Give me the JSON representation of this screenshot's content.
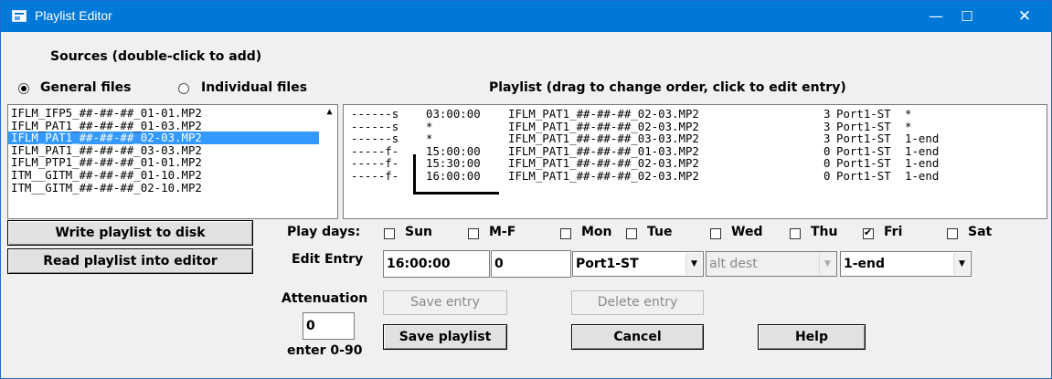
{
  "titlebar": {
    "title": "Playlist Editor",
    "minimize": "—",
    "maximize": "☐",
    "close": "✕"
  },
  "sources": {
    "heading": "Sources (double-click to add)",
    "radio_general": "General files",
    "radio_individual": "Individual files",
    "selected_radio": "general",
    "files": [
      "IFLM_IFP5_##-##-##_01-01.MP2",
      "IFLM_PAT1_##-##-##_01-03.MP2",
      "IFLM_PAT1_##-##-##_02-03.MP2",
      "IFLM_PAT1_##-##-##_03-03.MP2",
      "IFLM_PTP1_##-##-##_01-01.MP2",
      "ITM__GITM_##-##-##_01-10.MP2",
      "ITM__GITM_##-##-##_02-10.MP2"
    ],
    "selected_index": 2
  },
  "playlist": {
    "heading": "Playlist (drag to change order, click to edit entry)",
    "rows": [
      {
        "flags": "------s",
        "time": "03:00:00",
        "file": "IFLM_PAT1_##-##-##_02-03.MP2",
        "att": "3",
        "port": "Port1-ST",
        "end": "*"
      },
      {
        "flags": "------s",
        "time": "*",
        "file": "IFLM_PAT1_##-##-##_02-03.MP2",
        "att": "3",
        "port": "Port1-ST",
        "end": "*"
      },
      {
        "flags": "------s",
        "time": "*",
        "file": "IFLM_PAT1_##-##-##_03-03.MP2",
        "att": "3",
        "port": "Port1-ST",
        "end": "1-end"
      },
      {
        "flags": "-----f-",
        "time": "15:00:00",
        "file": "IFLM_PAT1_##-##-##_01-03.MP2",
        "att": "0",
        "port": "Port1-ST",
        "end": "1-end"
      },
      {
        "flags": "-----f-",
        "time": "15:30:00",
        "file": "IFLM_PAT1_##-##-##_02-03.MP2",
        "att": "0",
        "port": "Port1-ST",
        "end": "1-end"
      },
      {
        "flags": "-----f-",
        "time": "16:00:00",
        "file": "IFLM_PAT1_##-##-##_02-03.MP2",
        "att": "0",
        "port": "Port1-ST",
        "end": "1-end"
      }
    ]
  },
  "buttons": {
    "write": "Write playlist to disk",
    "read": "Read playlist into editor",
    "save_entry": "Save entry",
    "delete_entry": "Delete entry",
    "save_playlist": "Save playlist",
    "cancel": "Cancel",
    "help": "Help"
  },
  "play_days": {
    "label": "Play days:",
    "days": [
      {
        "name": "Sun",
        "checked": false
      },
      {
        "name": "M-F",
        "checked": false
      },
      {
        "name": "Mon",
        "checked": false
      },
      {
        "name": "Tue",
        "checked": false
      },
      {
        "name": "Wed",
        "checked": false
      },
      {
        "name": "Thu",
        "checked": false
      },
      {
        "name": "Fri",
        "checked": true
      },
      {
        "name": "Sat",
        "checked": false
      }
    ]
  },
  "edit_entry": {
    "label": "Edit Entry",
    "time": "16:00:00",
    "attenuation_value": "0",
    "port": "Port1-ST",
    "alt_dest": "alt dest",
    "end": "1-end"
  },
  "attenuation": {
    "label": "Attenuation",
    "value": "0",
    "hint": "enter 0-90"
  }
}
